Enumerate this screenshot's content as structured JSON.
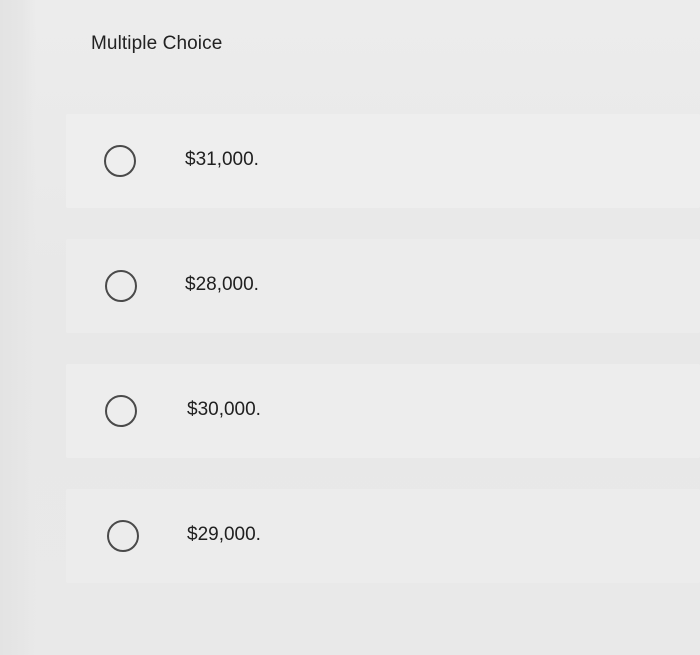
{
  "question": {
    "title": "Multiple Choice"
  },
  "options": [
    {
      "label": "$31,000."
    },
    {
      "label": "$28,000."
    },
    {
      "label": "$30,000."
    },
    {
      "label": "$29,000."
    }
  ]
}
